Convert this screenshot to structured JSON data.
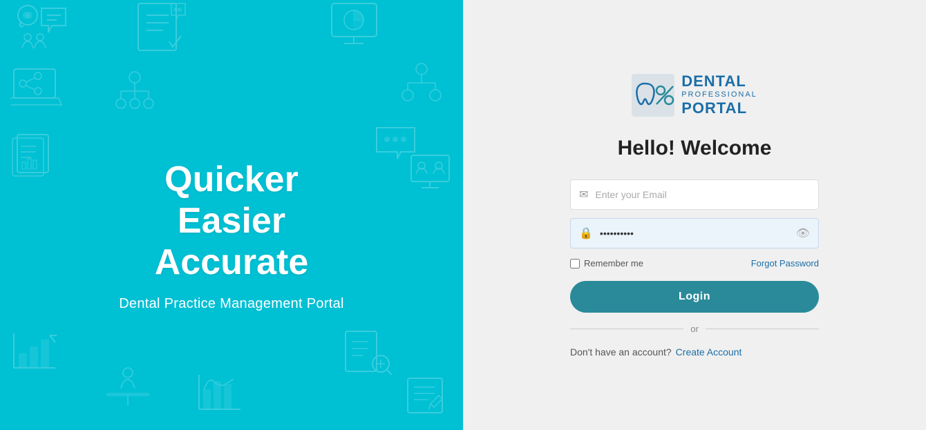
{
  "left": {
    "line1": "Quicker",
    "line2": "Easier",
    "line3": "Accurate",
    "subtitle": "Dental Practice Management Portal"
  },
  "right": {
    "logo": {
      "dental": "DENTAL",
      "professional": "PROFESSIONAL",
      "portal": "PORTAL"
    },
    "welcome": "Hello! Welcome",
    "email_placeholder": "Enter your Email",
    "password_placeholder": "••••••••••",
    "remember_label": "Remember me",
    "forgot_label": "Forgot Password",
    "login_label": "Login",
    "divider_or": "or",
    "no_account": "Don't have an account?",
    "create_account": "Create Account"
  }
}
